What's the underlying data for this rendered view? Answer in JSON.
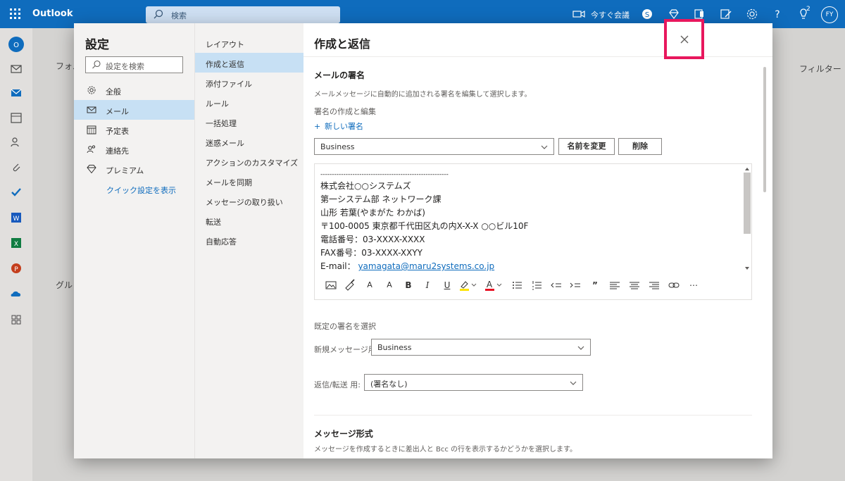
{
  "topbar": {
    "app_name": "Outlook",
    "search_placeholder": "検索",
    "meet_now": "今すぐ会議",
    "notification_count": "2",
    "avatar_initials": "FY",
    "color": "#0f6cbd"
  },
  "underlay": {
    "folder_label": "フォル",
    "filter_label": "フィルター",
    "groups_label": "グル"
  },
  "settings": {
    "title": "設定",
    "search_placeholder": "設定を検索",
    "categories": [
      {
        "label": "全般",
        "icon": "gear-icon"
      },
      {
        "label": "メール",
        "icon": "mail-icon",
        "selected": true
      },
      {
        "label": "予定表",
        "icon": "calendar-icon"
      },
      {
        "label": "連絡先",
        "icon": "people-icon"
      },
      {
        "label": "プレミアム",
        "icon": "diamond-icon"
      }
    ],
    "quick_settings_link": "クイック設定を表示",
    "mail_sections": [
      {
        "label": "レイアウト"
      },
      {
        "label": "作成と返信",
        "selected": true
      },
      {
        "label": "添付ファイル"
      },
      {
        "label": "ルール"
      },
      {
        "label": "一括処理"
      },
      {
        "label": "迷惑メール"
      },
      {
        "label": "アクションのカスタマイズ"
      },
      {
        "label": "メールを同期"
      },
      {
        "label": "メッセージの取り扱い"
      },
      {
        "label": "転送"
      },
      {
        "label": "自動応答"
      }
    ]
  },
  "content": {
    "header": "作成と返信",
    "signature": {
      "title": "メールの署名",
      "description": "メールメッセージに自動的に追加される署名を編集して選択します。",
      "create_edit_label": "署名の作成と編集",
      "new_signature": "新しい署名",
      "selected_signature": "Business",
      "rename_button": "名前を変更",
      "delete_button": "削除",
      "body_lines": [
        "--------------------------------------------------------",
        "株式会社○○システムズ",
        "第一システム部 ネットワーク課",
        "山形 若葉(やまがた わかば)",
        "〒100-0005 東京都千代田区丸の内X-X-X ○○ビル10F",
        "電話番号：03-XXXX-XXXX",
        "FAX番号：03-XXXX-XXYY"
      ],
      "email_label": "E-mail：",
      "email_address": "yamagata@maru2systems.co.jp"
    },
    "defaults": {
      "title": "既定の署名を選択",
      "new_message_label": "新規メッセージ用:",
      "new_message_value": "Business",
      "reply_label": "返信/転送 用:",
      "reply_value": "(署名なし)"
    },
    "message_format": {
      "title": "メッセージ形式",
      "description": "メッセージを作成するときに差出人と Bcc の行を表示するかどうかを選択します。"
    }
  },
  "highlight_color": "#e8175d"
}
